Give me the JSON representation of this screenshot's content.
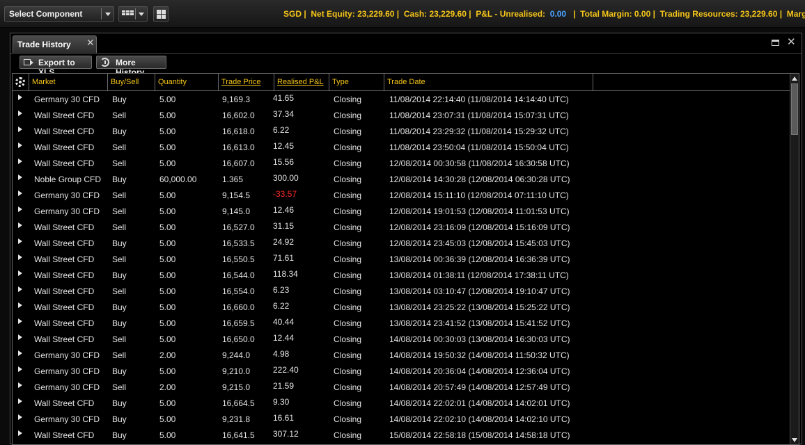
{
  "toolbar": {
    "select_component": "Select Component"
  },
  "account": {
    "currency": "SGD",
    "net_equity_label": "Net Equity:",
    "net_equity": "23,229.60",
    "cash_label": "Cash:",
    "cash": "23,229.60",
    "pnl_unrealised_label": "P&L - Unrealised:",
    "pnl_unrealised": "0.00",
    "total_margin_label": "Total Margin:",
    "total_margin": "0.00",
    "trading_resources_label": "Trading Resources:",
    "trading_resources": "23,229.60",
    "margin_indicator_label": "Margin Indicat"
  },
  "window": {
    "title": "Trade History",
    "export_label": "Export to XLS",
    "more_history_label": "More History"
  },
  "columns": [
    "Market",
    "Buy/Sell",
    "Quantity",
    "Trade Price",
    "Realised P&L",
    "Type",
    "Trade Date"
  ],
  "rows": [
    {
      "market": "Germany 30 CFD",
      "side": "Buy",
      "quantity": "5.00",
      "price": "9,169.3",
      "pnl": "41.65",
      "type": "Closing",
      "date": "11/08/2014 22:14:40 (11/08/2014 14:14:40 UTC)"
    },
    {
      "market": "Wall Street CFD",
      "side": "Sell",
      "quantity": "5.00",
      "price": "16,602.0",
      "pnl": "37.34",
      "type": "Closing",
      "date": "11/08/2014 23:07:31 (11/08/2014 15:07:31 UTC)"
    },
    {
      "market": "Wall Street CFD",
      "side": "Buy",
      "quantity": "5.00",
      "price": "16,618.0",
      "pnl": "6.22",
      "type": "Closing",
      "date": "11/08/2014 23:29:32 (11/08/2014 15:29:32 UTC)"
    },
    {
      "market": "Wall Street CFD",
      "side": "Sell",
      "quantity": "5.00",
      "price": "16,613.0",
      "pnl": "12.45",
      "type": "Closing",
      "date": "11/08/2014 23:50:04 (11/08/2014 15:50:04 UTC)"
    },
    {
      "market": "Wall Street CFD",
      "side": "Sell",
      "quantity": "5.00",
      "price": "16,607.0",
      "pnl": "15.56",
      "type": "Closing",
      "date": "12/08/2014 00:30:58 (11/08/2014 16:30:58 UTC)"
    },
    {
      "market": "Noble Group CFD",
      "side": "Buy",
      "quantity": "60,000.00",
      "price": "1.365",
      "pnl": "300.00",
      "type": "Closing",
      "date": "12/08/2014 14:30:28 (12/08/2014 06:30:28 UTC)"
    },
    {
      "market": "Germany 30 CFD",
      "side": "Sell",
      "quantity": "5.00",
      "price": "9,154.5",
      "pnl": "-33.57",
      "type": "Closing",
      "date": "12/08/2014 15:11:10 (12/08/2014 07:11:10 UTC)"
    },
    {
      "market": "Germany 30 CFD",
      "side": "Sell",
      "quantity": "5.00",
      "price": "9,145.0",
      "pnl": "12.46",
      "type": "Closing",
      "date": "12/08/2014 19:01:53 (12/08/2014 11:01:53 UTC)"
    },
    {
      "market": "Wall Street CFD",
      "side": "Sell",
      "quantity": "5.00",
      "price": "16,527.0",
      "pnl": "31.15",
      "type": "Closing",
      "date": "12/08/2014 23:16:09 (12/08/2014 15:16:09 UTC)"
    },
    {
      "market": "Wall Street CFD",
      "side": "Buy",
      "quantity": "5.00",
      "price": "16,533.5",
      "pnl": "24.92",
      "type": "Closing",
      "date": "12/08/2014 23:45:03 (12/08/2014 15:45:03 UTC)"
    },
    {
      "market": "Wall Street CFD",
      "side": "Sell",
      "quantity": "5.00",
      "price": "16,550.5",
      "pnl": "71.61",
      "type": "Closing",
      "date": "13/08/2014 00:36:39 (12/08/2014 16:36:39 UTC)"
    },
    {
      "market": "Wall Street CFD",
      "side": "Buy",
      "quantity": "5.00",
      "price": "16,544.0",
      "pnl": "118.34",
      "type": "Closing",
      "date": "13/08/2014 01:38:11 (12/08/2014 17:38:11 UTC)"
    },
    {
      "market": "Wall Street CFD",
      "side": "Sell",
      "quantity": "5.00",
      "price": "16,554.0",
      "pnl": "6.23",
      "type": "Closing",
      "date": "13/08/2014 03:10:47 (12/08/2014 19:10:47 UTC)"
    },
    {
      "market": "Wall Street CFD",
      "side": "Buy",
      "quantity": "5.00",
      "price": "16,660.0",
      "pnl": "6.22",
      "type": "Closing",
      "date": "13/08/2014 23:25:22 (13/08/2014 15:25:22 UTC)"
    },
    {
      "market": "Wall Street CFD",
      "side": "Buy",
      "quantity": "5.00",
      "price": "16,659.5",
      "pnl": "40.44",
      "type": "Closing",
      "date": "13/08/2014 23:41:52 (13/08/2014 15:41:52 UTC)"
    },
    {
      "market": "Wall Street CFD",
      "side": "Sell",
      "quantity": "5.00",
      "price": "16,650.0",
      "pnl": "12.44",
      "type": "Closing",
      "date": "14/08/2014 00:30:03 (13/08/2014 16:30:03 UTC)"
    },
    {
      "market": "Germany 30 CFD",
      "side": "Sell",
      "quantity": "2.00",
      "price": "9,244.0",
      "pnl": "4.98",
      "type": "Closing",
      "date": "14/08/2014 19:50:32 (14/08/2014 11:50:32 UTC)"
    },
    {
      "market": "Germany 30 CFD",
      "side": "Buy",
      "quantity": "5.00",
      "price": "9,210.0",
      "pnl": "222.40",
      "type": "Closing",
      "date": "14/08/2014 20:36:04 (14/08/2014 12:36:04 UTC)"
    },
    {
      "market": "Germany 30 CFD",
      "side": "Sell",
      "quantity": "2.00",
      "price": "9,215.0",
      "pnl": "21.59",
      "type": "Closing",
      "date": "14/08/2014 20:57:49 (14/08/2014 12:57:49 UTC)"
    },
    {
      "market": "Wall Street CFD",
      "side": "Buy",
      "quantity": "5.00",
      "price": "16,664.5",
      "pnl": "9.30",
      "type": "Closing",
      "date": "14/08/2014 22:02:01 (14/08/2014 14:02:01 UTC)"
    },
    {
      "market": "Germany 30 CFD",
      "side": "Buy",
      "quantity": "5.00",
      "price": "9,231.8",
      "pnl": "16.61",
      "type": "Closing",
      "date": "14/08/2014 22:02:10 (14/08/2014 14:02:10 UTC)"
    },
    {
      "market": "Wall Street CFD",
      "side": "Buy",
      "quantity": "5.00",
      "price": "16,641.5",
      "pnl": "307.12",
      "type": "Closing",
      "date": "15/08/2014 22:58:18 (15/08/2014 14:58:18 UTC)"
    }
  ],
  "colors": {
    "header_text": "#f5c518",
    "negative": "#ff2a2a",
    "link_blue": "#4aa3ff"
  }
}
